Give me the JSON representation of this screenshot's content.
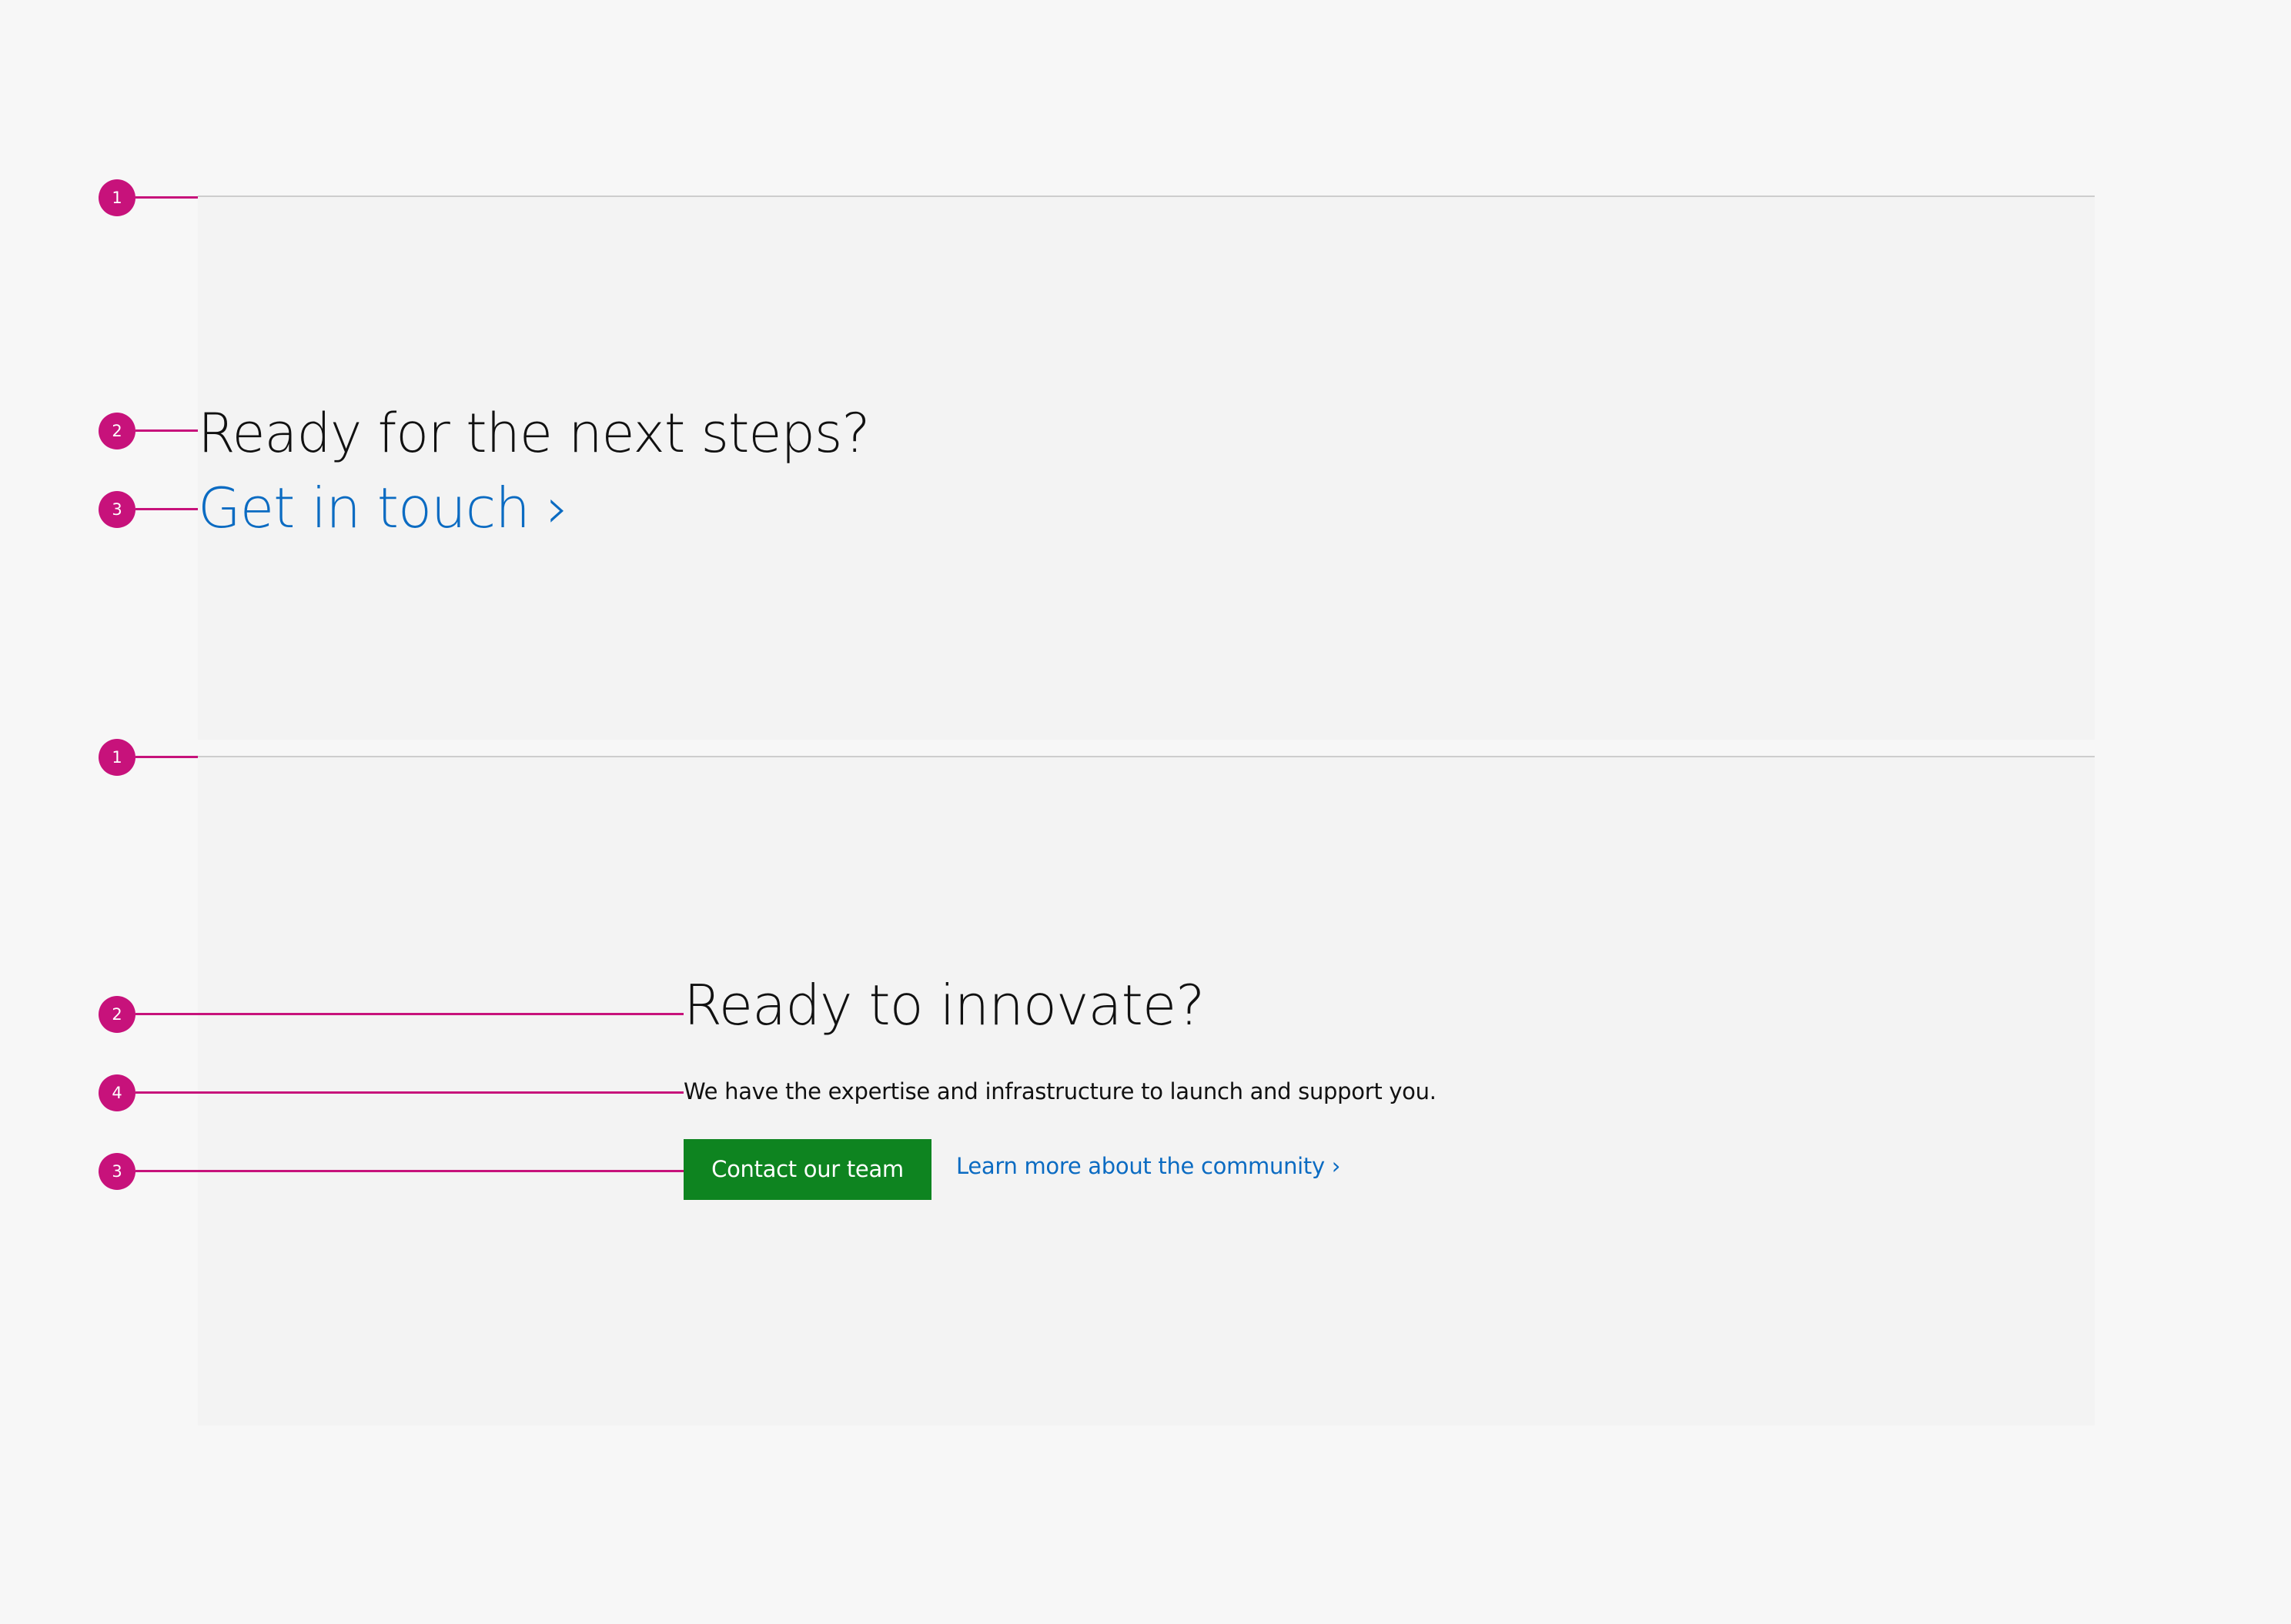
{
  "colors": {
    "page_background": "#f7f7f7",
    "panel_background": "#f3f3f3",
    "rule": "#cdcdcd",
    "annotation_accent": "#c7127b",
    "link": "#0b6bc2",
    "button_positive": "#0e8420",
    "text": "#111111"
  },
  "annotations": {
    "panel1": [
      "1",
      "2",
      "3"
    ],
    "panel2": [
      "1",
      "2",
      "4",
      "3"
    ]
  },
  "example1": {
    "heading": "Ready for the next steps?",
    "link_label": "Get in touch ›"
  },
  "example2": {
    "heading": "Ready to innovate?",
    "description": "We have the expertise and infrastructure to launch and support you.",
    "button_label": "Contact our team",
    "link_label": "Learn more about the community ›"
  }
}
